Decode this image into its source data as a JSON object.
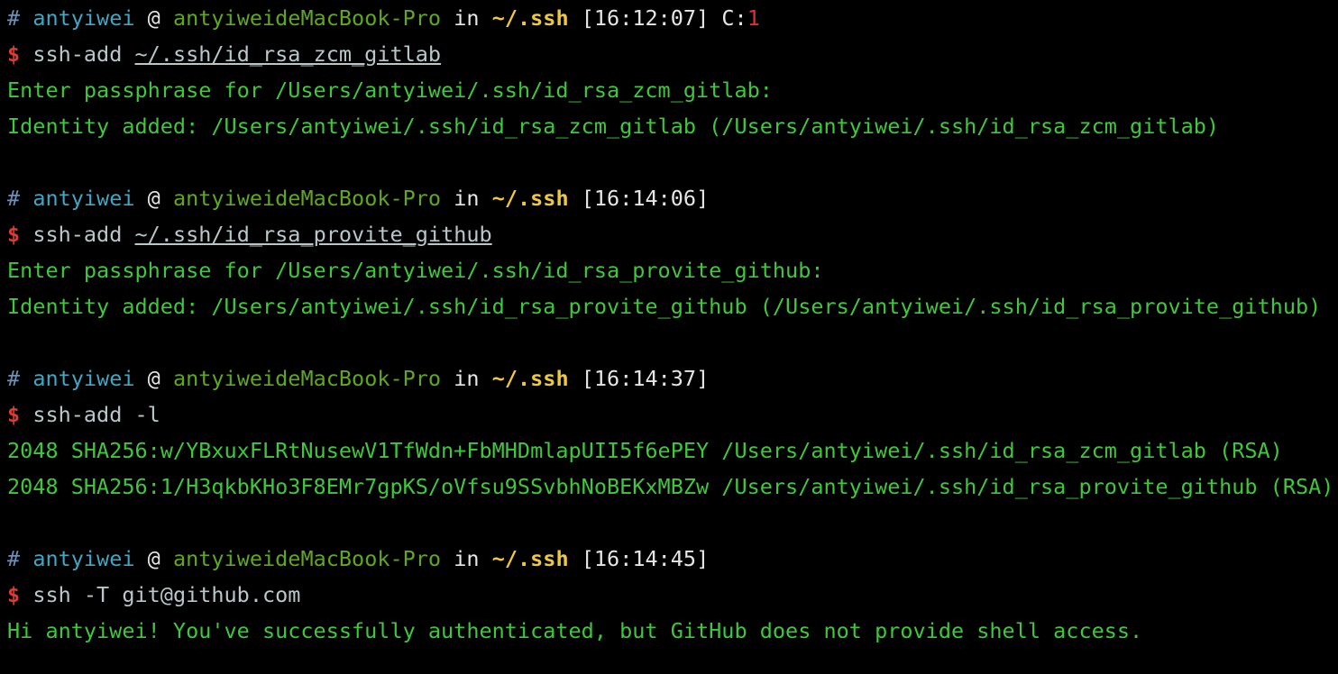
{
  "colors": {
    "background": "#000000",
    "hash": "#6b8fb8",
    "user": "#3fa6c4",
    "host": "#5fa81e",
    "path": "#f0c93a",
    "dollar": "#e03a2f",
    "exit_code": "#e03030",
    "output": "#3fc83b",
    "command": "#b8c7c9"
  },
  "blocks": [
    {
      "prompt": {
        "hash": "#",
        "user": "antyiwei",
        "at": "@",
        "host": "antyiweideMacBook-Pro",
        "in": "in",
        "path": "~/.ssh",
        "time": "[16:12:07]",
        "code_label": "C:",
        "code_value": "1"
      },
      "command": {
        "dollar": "$",
        "cmd": "ssh-add",
        "arg": "~/.ssh/id_rsa_zcm_gitlab"
      },
      "output": [
        "Enter passphrase for /Users/antyiwei/.ssh/id_rsa_zcm_gitlab:",
        "Identity added: /Users/antyiwei/.ssh/id_rsa_zcm_gitlab (/Users/antyiwei/.ssh/id_rsa_zcm_gitlab)"
      ]
    },
    {
      "prompt": {
        "hash": "#",
        "user": "antyiwei",
        "at": "@",
        "host": "antyiweideMacBook-Pro",
        "in": "in",
        "path": "~/.ssh",
        "time": "[16:14:06]"
      },
      "command": {
        "dollar": "$",
        "cmd": "ssh-add",
        "arg": "~/.ssh/id_rsa_provite_github"
      },
      "output": [
        "Enter passphrase for /Users/antyiwei/.ssh/id_rsa_provite_github:",
        "Identity added: /Users/antyiwei/.ssh/id_rsa_provite_github (/Users/antyiwei/.ssh/id_rsa_provite_github)"
      ]
    },
    {
      "prompt": {
        "hash": "#",
        "user": "antyiwei",
        "at": "@",
        "host": "antyiweideMacBook-Pro",
        "in": "in",
        "path": "~/.ssh",
        "time": "[16:14:37]"
      },
      "command": {
        "dollar": "$",
        "cmd": "ssh-add -l"
      },
      "output": [
        "2048 SHA256:w/YBxuxFLRtNusewV1TfWdn+FbMHDmlapUII5f6ePEY /Users/antyiwei/.ssh/id_rsa_zcm_gitlab (RSA)",
        "2048 SHA256:1/H3qkbKHo3F8EMr7gpKS/oVfsu9SSvbhNoBEKxMBZw /Users/antyiwei/.ssh/id_rsa_provite_github (RSA)"
      ]
    },
    {
      "prompt": {
        "hash": "#",
        "user": "antyiwei",
        "at": "@",
        "host": "antyiweideMacBook-Pro",
        "in": "in",
        "path": "~/.ssh",
        "time": "[16:14:45]"
      },
      "command": {
        "dollar": "$",
        "cmd": "ssh -T git@github.com"
      },
      "output": [
        "Hi antyiwei! You've successfully authenticated, but GitHub does not provide shell access."
      ]
    }
  ]
}
